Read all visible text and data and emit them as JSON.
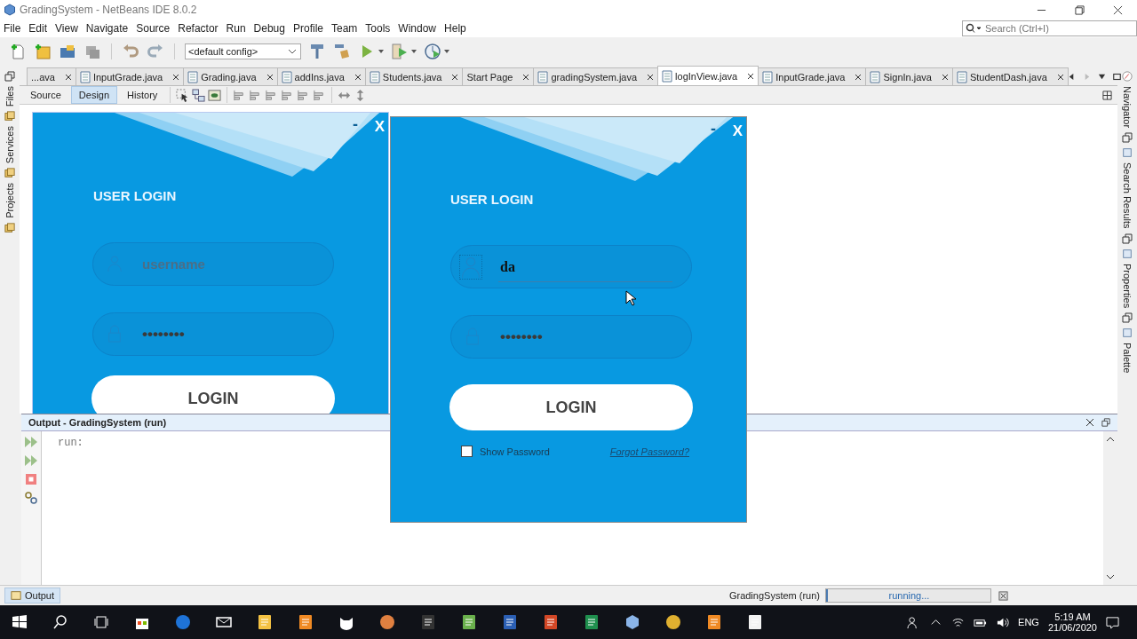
{
  "window": {
    "title": "GradingSystem - NetBeans IDE 8.0.2",
    "search": {
      "placeholder": "Search (Ctrl+I)"
    }
  },
  "menu": [
    "File",
    "Edit",
    "View",
    "Navigate",
    "Source",
    "Refactor",
    "Run",
    "Debug",
    "Profile",
    "Team",
    "Tools",
    "Window",
    "Help"
  ],
  "toolbar": {
    "config": "<default config>"
  },
  "editor_tabs": [
    {
      "label": "...ava",
      "selected": false
    },
    {
      "label": "InputGrade.java",
      "selected": false
    },
    {
      "label": "Grading.java",
      "selected": false
    },
    {
      "label": "addIns.java",
      "selected": false
    },
    {
      "label": "Students.java",
      "selected": false
    },
    {
      "label": "Start Page",
      "selected": false
    },
    {
      "label": "gradingSystem.java",
      "selected": false
    },
    {
      "label": "logInView.java",
      "selected": true
    },
    {
      "label": "InputGrade.java",
      "selected": false
    },
    {
      "label": "SignIn.java",
      "selected": false
    },
    {
      "label": "StudentDash.java",
      "selected": false
    }
  ],
  "view_tabs": [
    {
      "label": "Source",
      "selected": false
    },
    {
      "label": "Design",
      "selected": true
    },
    {
      "label": "History",
      "selected": false
    }
  ],
  "left_panels": [
    "Files",
    "Services",
    "Projects"
  ],
  "right_panels": [
    "Navigator",
    "Search Results",
    "Properties",
    "Palette"
  ],
  "design_form": {
    "minimize": "-",
    "close": "X",
    "title": "USER LOGIN",
    "username": {
      "placeholder": "username"
    },
    "password": {
      "value": "••••••••"
    },
    "login_button": "LOGIN"
  },
  "running_form": {
    "minimize": "-",
    "close": "X",
    "title": "USER LOGIN",
    "username": {
      "value": "da"
    },
    "password": {
      "value": "••••••••"
    },
    "login_button": "LOGIN",
    "show_password": {
      "label": "Show Password",
      "checked": false
    },
    "forgot_link": "Forgot Password?"
  },
  "output": {
    "title": "Output - GradingSystem (run)",
    "text": "run:"
  },
  "status_bar": {
    "output_tab": "Output",
    "task": "GradingSystem (run)",
    "progress": "running...",
    "level": 0.01
  },
  "taskbar": {
    "language": "ENG",
    "time": "5:19 AM",
    "date": "21/06/2020"
  }
}
